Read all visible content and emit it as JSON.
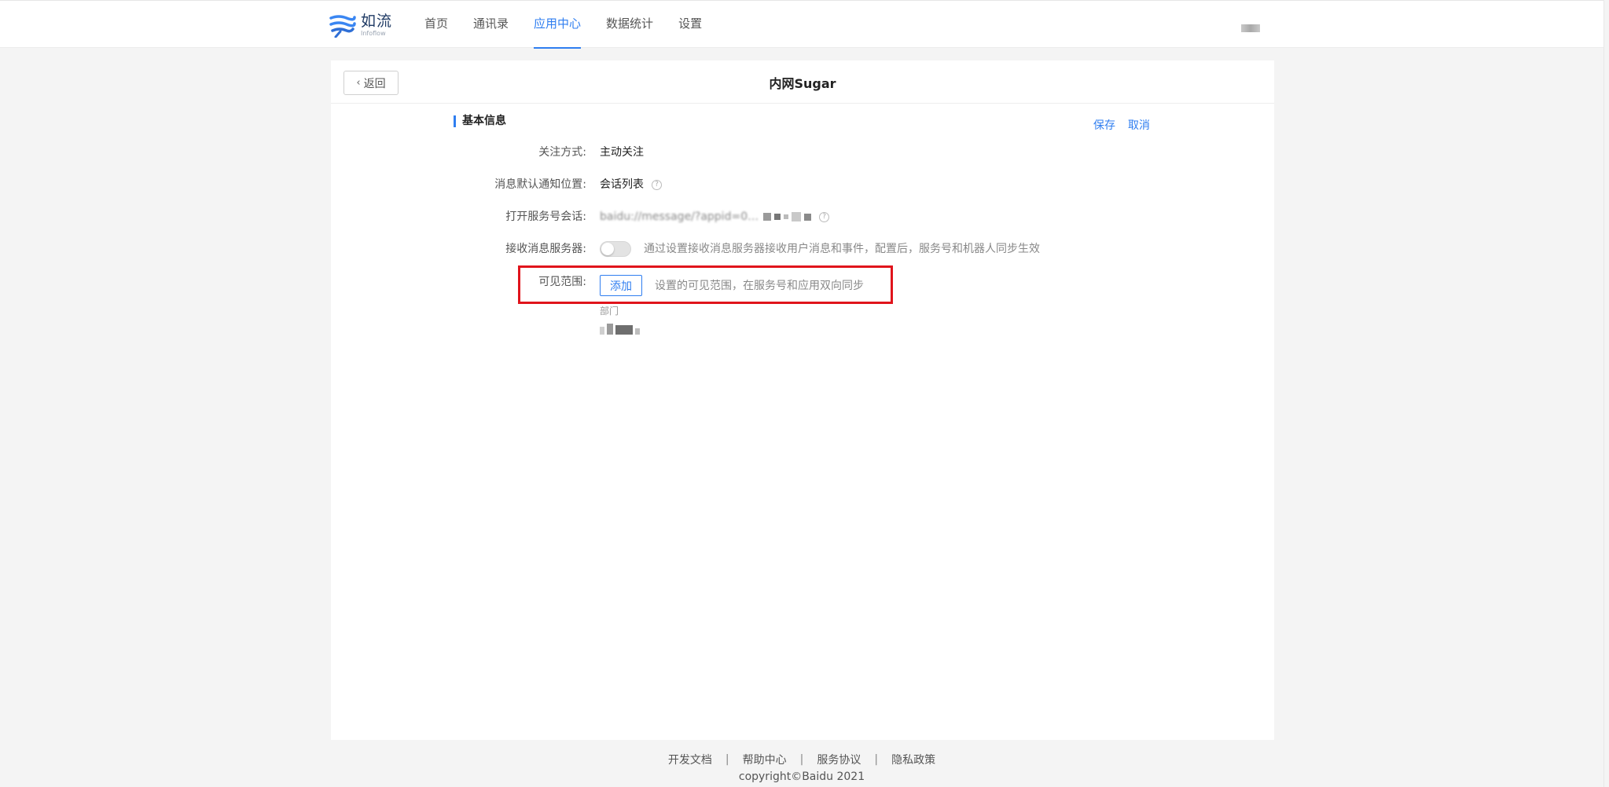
{
  "header": {
    "logo_name": "如流",
    "logo_sub": "Infoflow",
    "nav": [
      {
        "label": "首页",
        "active": false
      },
      {
        "label": "通讯录",
        "active": false
      },
      {
        "label": "应用中心",
        "active": true
      },
      {
        "label": "数据统计",
        "active": false
      },
      {
        "label": "设置",
        "active": false
      }
    ]
  },
  "page": {
    "back_label": "返回",
    "title": "内网Sugar",
    "section_title": "基本信息",
    "save_label": "保存",
    "cancel_label": "取消"
  },
  "form": {
    "follow_label": "关注方式:",
    "follow_value": "主动关注",
    "notify_label": "消息默认通知位置:",
    "notify_value": "会话列表",
    "session_label": "打开服务号会话:",
    "session_value": "baidu://message/?appid=0…",
    "server_label": "接收消息服务器:",
    "server_hint": "通过设置接收消息服务器接收用户消息和事件，配置后，服务号和机器人同步生效",
    "server_enabled": false,
    "scope_label": "可见范围:",
    "scope_add_label": "添加",
    "scope_hint": "设置的可见范围，在服务号和应用双向同步",
    "dept_label": "部门"
  },
  "footer": {
    "links": [
      "开发文档",
      "帮助中心",
      "服务协议",
      "隐私政策"
    ],
    "separator": "|",
    "copyright": "copyright©Baidu 2021"
  },
  "colors": {
    "accent": "#2f7ef0",
    "highlight": "#e0141c"
  }
}
